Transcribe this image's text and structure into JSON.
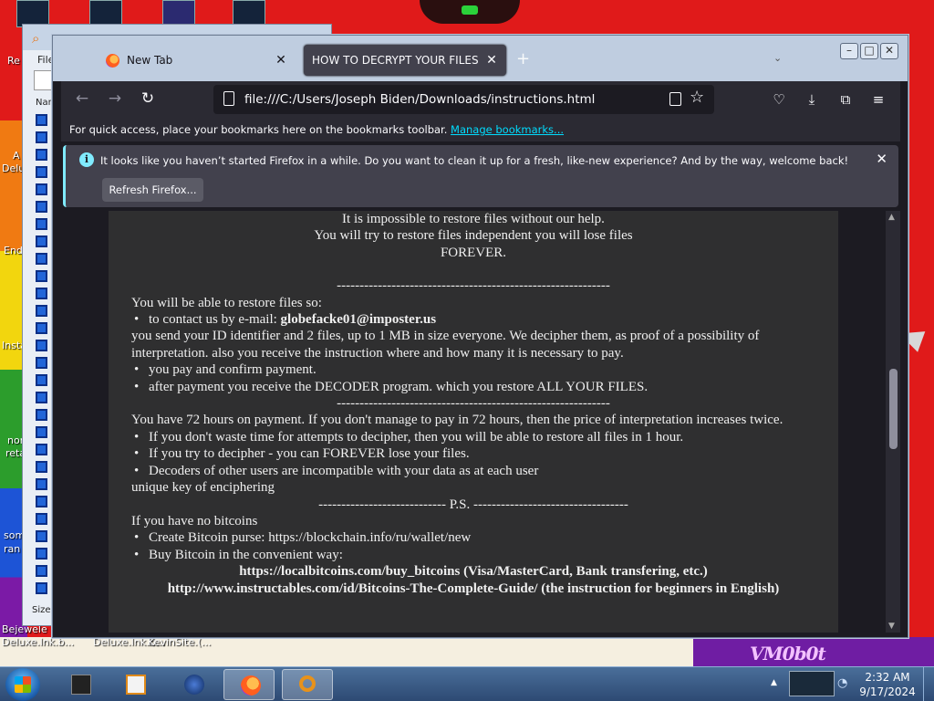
{
  "desktop": {
    "icons_top": [
      "",
      "",
      "",
      ""
    ],
    "left_labels": [
      "Re",
      "A",
      "Delu",
      "End",
      "Insta",
      "non",
      "reta",
      "som",
      "ran"
    ],
    "bottom_labels": [
      "Bejewele\nDeluxe.lnk.b...",
      "Deluxe.lnk.b...",
      "KevinSite.(..."
    ],
    "wallpaper_mark": "VM0b0t"
  },
  "explorer": {
    "menu": "File",
    "column_header": "Nam",
    "footer": "Size:"
  },
  "browser": {
    "tabs": [
      {
        "label": "New Tab",
        "active": false
      },
      {
        "label": "HOW TO DECRYPT YOUR FILES",
        "active": true
      }
    ],
    "new_tab_symbol": "+",
    "url": "file:///C:/Users/Joseph Biden/Downloads/instructions.html",
    "bookmarks_hint": "For quick access, place your bookmarks here on the bookmarks toolbar.",
    "bookmarks_link": "Manage bookmarks...",
    "notification": {
      "message": "It looks like you haven’t started Firefox in a while. Do you want to clean it up for a fresh, like-new experience? And by the way, welcome back!",
      "button": "Refresh Firefox..."
    }
  },
  "page": {
    "intro1": "It is impossible to restore files without our help.",
    "intro2": "You will try to restore files independent you will lose files",
    "intro3": "FOREVER.",
    "divider1": "------------------------------------------------------------",
    "restore_heading": "You will be able to restore files so:",
    "contact_prefix": "to contact us by e-mail: ",
    "email": "globefacke01@imposter.us",
    "send_text": "you send your ID identifier and 2 files, up to 1 MB in size everyone. We decipher them, as proof of a possibility of interpretation. also you receive the instruction where and how many it is necessary to pay.",
    "pay_item": "you pay and confirm payment.",
    "decoder_item": "after payment you receive the DECODER program. which you restore ALL YOUR FILES.",
    "divider2": "------------------------------------------------------------",
    "hours_text": "You have 72 hours on payment. If you don't manage to pay in 72 hours, then the price of interpretation increases twice.",
    "waste_item": "If you don't waste time for attempts to decipher, then you will be able to restore all files in 1 hour.",
    "forever_item": "If you try to decipher - you can FOREVER lose your files.",
    "decoders_item": "Decoders of other users are incompatible with your data as at each user",
    "unique_key": "unique key of enciphering",
    "ps_line": "---------------------------- P.S. ----------------------------------",
    "no_bitcoins": "If you have no bitcoins",
    "purse_item": "Create Bitcoin purse: https://blockchain.info/ru/wallet/new",
    "buy_item": "Buy Bitcoin in the convenient way:",
    "link1": "https://localbitcoins.com/buy_bitcoins (Visa/MasterCard, Bank transfering, etc.)",
    "link2": "http://www.instructables.com/id/Bitcoins-The-Complete-Guide/ (the instruction for beginners in English)"
  },
  "taskbar": {
    "time": "2:32 AM",
    "date": "9/17/2024"
  },
  "colors": {
    "firefox_dark": "#1c1b22",
    "toolbar": "#2b2a33",
    "link": "#00ddff",
    "ransom_bg": "#2f2f30"
  }
}
